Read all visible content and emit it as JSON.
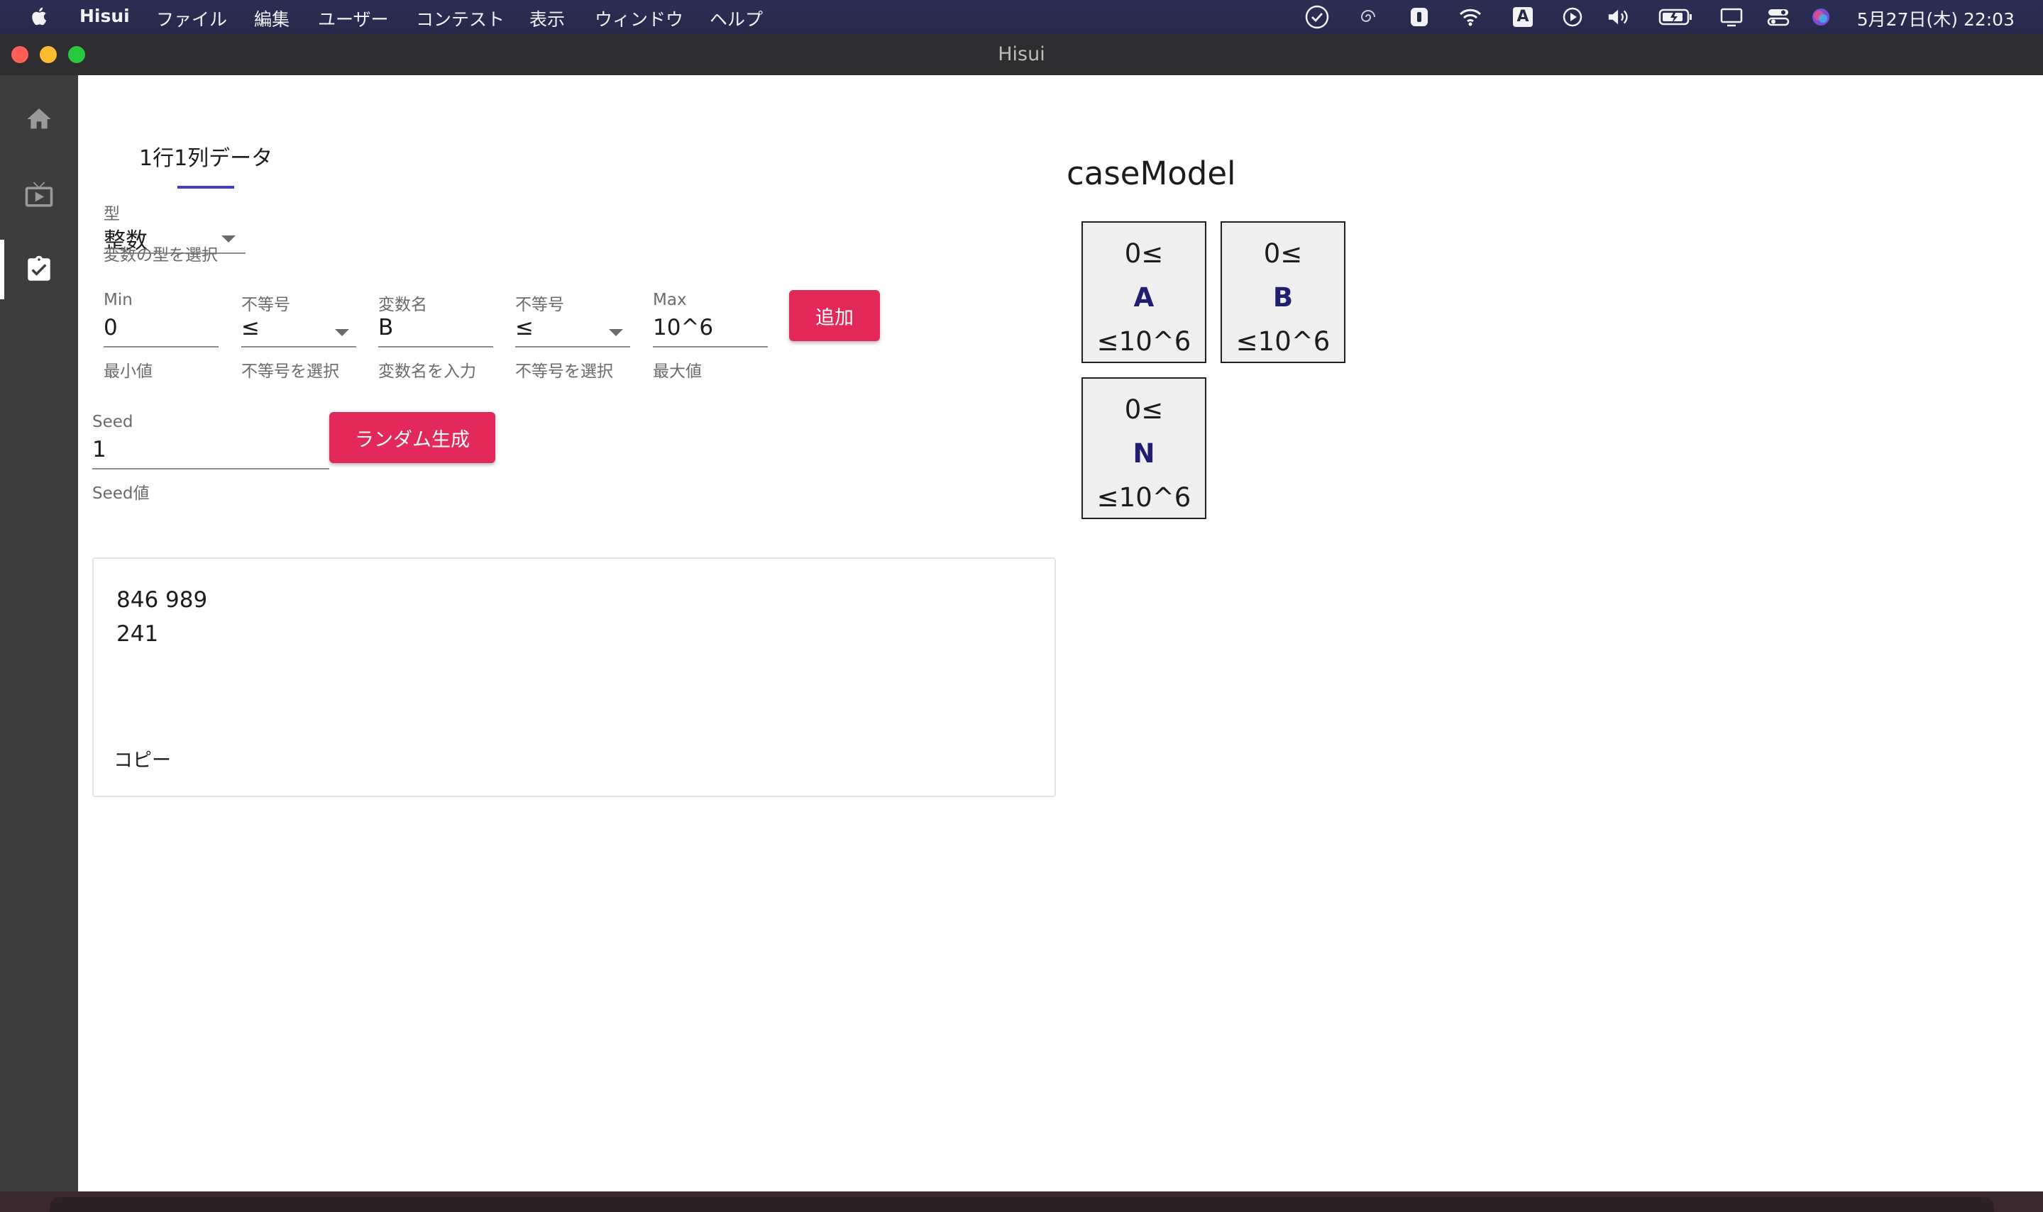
{
  "menubar": {
    "app_name": "Hisui",
    "menus": [
      "ファイル",
      "編集",
      "ユーザー",
      "コンテスト",
      "表示",
      "ウィンドウ",
      "ヘルプ"
    ],
    "status_icons": [
      "check-circle-icon",
      "spiral-icon",
      "password-manager-icon",
      "wifi-icon",
      "input-source-icon",
      "play-circle-icon",
      "volume-icon",
      "battery-icon",
      "display-icon",
      "control-center-icon",
      "siri-icon"
    ],
    "input_source_letter": "A",
    "clock": "5月27日(木)  22:03"
  },
  "window": {
    "title": "Hisui",
    "traffic_colors": [
      "#ff5f57",
      "#febc2e",
      "#28c840"
    ]
  },
  "sidebar": {
    "items": [
      {
        "icon": "home-icon",
        "active": false
      },
      {
        "icon": "tv-play-icon",
        "active": false
      },
      {
        "icon": "clipboard-check-icon",
        "active": true
      }
    ]
  },
  "tab": {
    "label": "1行1列データ",
    "indicator_color": "#3f3fb8"
  },
  "type_field": {
    "label": "型",
    "value": "整数",
    "hint": "変数の型を選択"
  },
  "constraint": {
    "min": {
      "label": "Min",
      "value": "0",
      "hint": "最小値"
    },
    "op1": {
      "label": "不等号",
      "value": "≤",
      "hint": "不等号を選択"
    },
    "var": {
      "label": "変数名",
      "value": "B",
      "hint": "変数名を入力"
    },
    "op2": {
      "label": "不等号",
      "value": "≤",
      "hint": "不等号を選択"
    },
    "max": {
      "label": "Max",
      "value": "10^6",
      "hint": "最大値"
    },
    "add_button": "追加"
  },
  "seed": {
    "label": "Seed",
    "value": "1",
    "hint": "Seed値",
    "generate_button": "ランダム生成"
  },
  "output": {
    "text": "846 989\n241",
    "copy_button": "コピー"
  },
  "case_model": {
    "title": "caseModel",
    "variables": [
      {
        "lower": "0≤",
        "name": "A",
        "upper": "≤10^6"
      },
      {
        "lower": "0≤",
        "name": "B",
        "upper": "≤10^6"
      },
      {
        "lower": "0≤",
        "name": "N",
        "upper": "≤10^6"
      }
    ]
  },
  "colors": {
    "accent_button": "#e3285a",
    "sidebar_bg": "#3d3d3d",
    "variable_name": "#1f1f6e"
  }
}
